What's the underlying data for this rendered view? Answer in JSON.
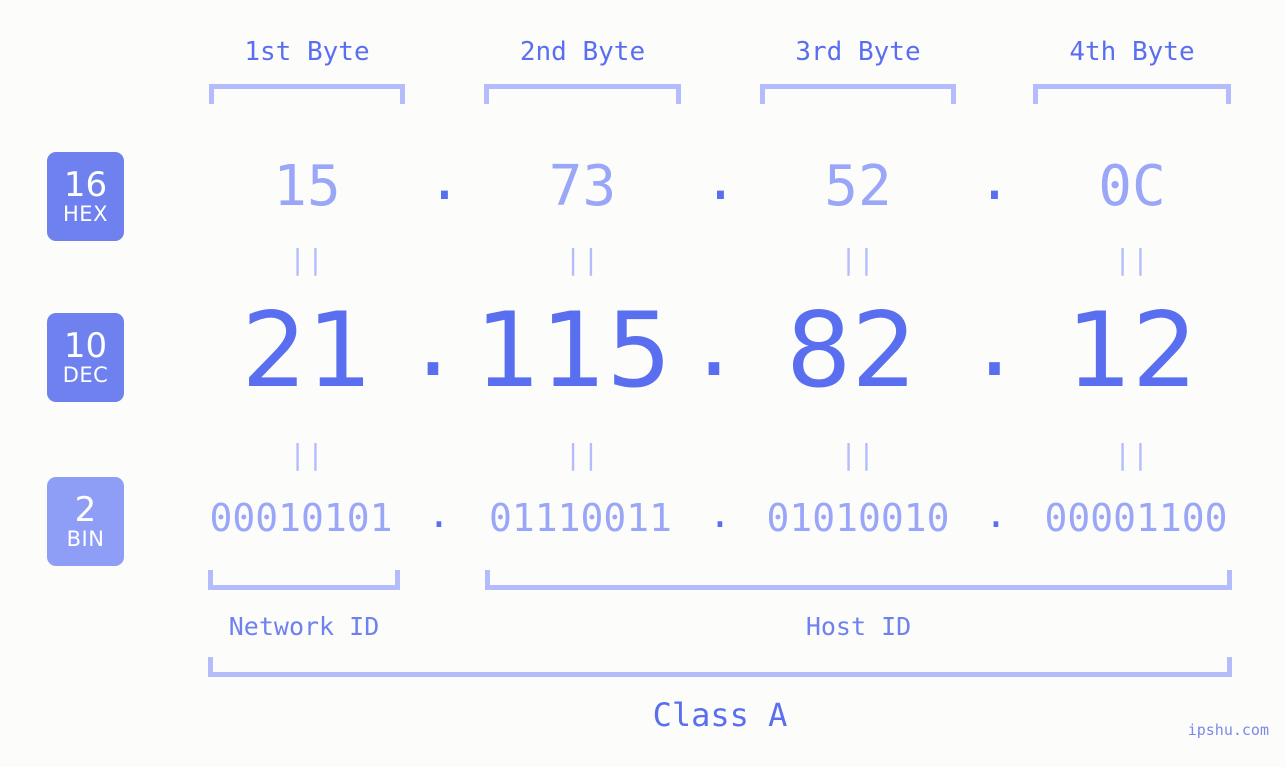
{
  "page": {
    "background_color": "#fcfdfa",
    "accent_color": "#5a6ff0",
    "accent_light": "#9aa6f7",
    "bracket_color": "#b4bcfb",
    "badge_color": "#6f81ef",
    "badge_color_light": "#8e9ef7"
  },
  "byte_headers": [
    {
      "label": "1st Byte"
    },
    {
      "label": "2nd Byte"
    },
    {
      "label": "3rd Byte"
    },
    {
      "label": "4th Byte"
    }
  ],
  "bases": [
    {
      "number": "16",
      "abbr": "HEX"
    },
    {
      "number": "10",
      "abbr": "DEC"
    },
    {
      "number": "2",
      "abbr": "BIN"
    }
  ],
  "rows": {
    "hex": {
      "base_number": "16",
      "base_abbr": "HEX",
      "values": [
        "15",
        "73",
        "52",
        "0C"
      ],
      "separators": [
        ".",
        ".",
        "."
      ]
    },
    "dec": {
      "base_number": "10",
      "base_abbr": "DEC",
      "values": [
        "21",
        "115",
        "82",
        "12"
      ],
      "separators": [
        ".",
        ".",
        "."
      ]
    },
    "bin": {
      "base_number": "2",
      "base_abbr": "BIN",
      "values": [
        "00010101",
        "01110011",
        "01010010",
        "00001100"
      ],
      "separators": [
        ".",
        ".",
        "."
      ]
    }
  },
  "equals_connectors": {
    "symbol": "||",
    "hex_to_dec": [
      "||",
      "||",
      "||",
      "||"
    ],
    "dec_to_bin": [
      "||",
      "||",
      "||",
      "||"
    ]
  },
  "sections": [
    {
      "label": "Network ID"
    },
    {
      "label": "Host ID"
    }
  ],
  "class": {
    "label": "Class A"
  },
  "watermark": {
    "text": "ipshu.com"
  }
}
